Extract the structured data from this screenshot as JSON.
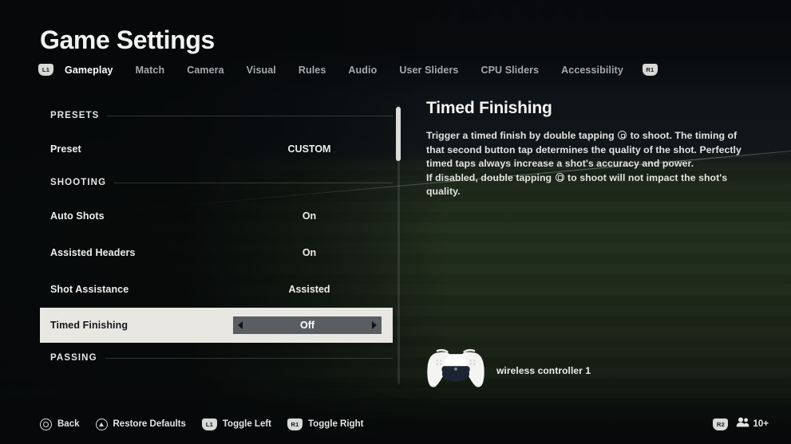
{
  "header": {
    "title": "Game Settings",
    "tab_prev_badge": "L1",
    "tab_next_badge": "R1",
    "tabs": [
      {
        "label": "Gameplay",
        "active": true
      },
      {
        "label": "Match",
        "active": false
      },
      {
        "label": "Camera",
        "active": false
      },
      {
        "label": "Visual",
        "active": false
      },
      {
        "label": "Rules",
        "active": false
      },
      {
        "label": "Audio",
        "active": false
      },
      {
        "label": "User Sliders",
        "active": false
      },
      {
        "label": "CPU Sliders",
        "active": false
      },
      {
        "label": "Accessibility",
        "active": false
      }
    ]
  },
  "settings_list": [
    {
      "type": "section",
      "label": "PRESETS"
    },
    {
      "type": "row",
      "name": "Preset",
      "value": "CUSTOM",
      "selected": false
    },
    {
      "type": "section",
      "label": "SHOOTING"
    },
    {
      "type": "row",
      "name": "Auto Shots",
      "value": "On",
      "selected": false
    },
    {
      "type": "row",
      "name": "Assisted Headers",
      "value": "On",
      "selected": false
    },
    {
      "type": "row",
      "name": "Shot Assistance",
      "value": "Assisted",
      "selected": false
    },
    {
      "type": "row",
      "name": "Timed Finishing",
      "value": "Off",
      "selected": true
    },
    {
      "type": "section",
      "label": "PASSING"
    }
  ],
  "detail": {
    "title": "Timed Finishing",
    "paragraphs": [
      {
        "pre": "Trigger a timed finish by double tapping ",
        "glyph": "ps-square-button-icon",
        "post": " to shoot. The timing of that second button tap determines the quality of the shot. Perfectly timed taps always increase a shot's accuracy and power."
      },
      {
        "pre": "If disabled, double tapping ",
        "glyph": "ps-square-button-icon",
        "post": " to shoot will not impact the shot's quality."
      }
    ]
  },
  "controller": {
    "label": "wireless controller 1",
    "icon": "dualsense-controller-icon"
  },
  "footer": {
    "hints": [
      {
        "icon": "circle-button-icon",
        "badge": null,
        "label": "Back"
      },
      {
        "icon": "triangle-button-icon",
        "badge": null,
        "label": "Restore Defaults"
      },
      {
        "icon": null,
        "badge": "L1",
        "label": "Toggle Left"
      },
      {
        "icon": null,
        "badge": "R1",
        "label": "Toggle Right"
      }
    ],
    "right": {
      "badge": "R2",
      "players_count": "10+",
      "players_icon": "people-icon"
    }
  },
  "colors": {
    "selected_row_bg": "#e9e7e1",
    "stepper_bg": "#5a5e63",
    "text_primary": "#eeeeec",
    "text_muted": "#a6a9ab",
    "badge_bg": "#d8d8d6"
  }
}
